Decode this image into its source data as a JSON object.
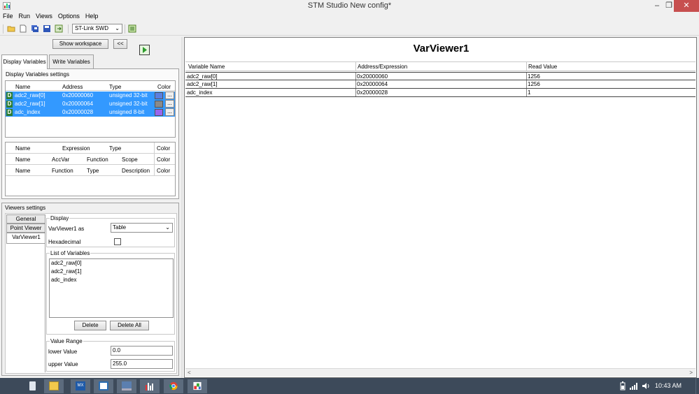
{
  "window": {
    "title": "STM Studio New config*",
    "controls": [
      "–",
      "❐",
      "✕"
    ]
  },
  "menu": [
    "File",
    "Run",
    "Views",
    "Options",
    "Help"
  ],
  "toolbar": {
    "probe_select": "ST-Link SWD",
    "probe_arrow": "⌄"
  },
  "left": {
    "show_workspace": "Show workspace",
    "collapse": "<<",
    "tabs": [
      "Display Variables",
      "Write Variables"
    ],
    "display_settings_label": "Display Variables settings",
    "var_headers": {
      "name": "Name",
      "address": "Address",
      "type": "Type",
      "color": "Color"
    },
    "variables": [
      {
        "badge": "D",
        "name": "adc2_raw[0]",
        "address": "0x20000060",
        "type": "unsigned 32-bit",
        "color": "#5b7fe0",
        "more": "..."
      },
      {
        "badge": "D",
        "name": "adc2_raw[1]",
        "address": "0x20000064",
        "type": "unsigned 32-bit",
        "color": "#8a8a8a",
        "more": "..."
      },
      {
        "badge": "D",
        "name": "adc_index",
        "address": "0x20000028",
        "type": "unsigned 8-bit",
        "color": "#9966ee",
        "more": "..."
      }
    ],
    "expr_headers": {
      "name": "Name",
      "expression": "Expression",
      "type": "Type",
      "color": "Color"
    },
    "acc_headers": {
      "name": "Name",
      "accvar": "AccVar",
      "function": "Function",
      "scope": "Scope",
      "color": "Color"
    },
    "func_headers": {
      "name": "Name",
      "function": "Function",
      "type": "Type",
      "description": "Description",
      "color": "Color"
    }
  },
  "viewers_settings": {
    "label": "Viewers settings",
    "tabs": [
      "General",
      "Point Viewer",
      "VarViewer1"
    ],
    "display_group": "Display",
    "display_as_label": "VarViewer1 as",
    "display_as_value": "Table",
    "hex_label": "Hexadecimal",
    "hex_checked": false,
    "list_group": "List of Variables",
    "list_items": [
      "adc2_raw[0]",
      "adc2_raw[1]",
      "adc_index"
    ],
    "delete": "Delete",
    "delete_all": "Delete All",
    "range_group": "Value Range",
    "lower_label": "lower Value",
    "lower_value": "0.0",
    "upper_label": "upper Value",
    "upper_value": "255.0"
  },
  "viewer": {
    "title": "VarViewer1",
    "headers": {
      "name": "Variable Name",
      "address": "Address/Expression",
      "value": "Read Value"
    },
    "rows": [
      {
        "name": "adc2_raw[0]",
        "address": "0x20000060",
        "value": "1256"
      },
      {
        "name": "adc2_raw[1]",
        "address": "0x20000064",
        "value": "1256"
      },
      {
        "name": "adc_index",
        "address": "0x20000028",
        "value": "1"
      }
    ],
    "scroll_left": "<",
    "scroll_right": ">"
  },
  "taskbar": {
    "clock": "10:43 AM",
    "apps": [
      "phone-app",
      "file-explorer",
      "stm32cubemx",
      "app-store-window",
      "remote-desktop",
      "stm-studio",
      "chrome",
      "paint"
    ],
    "tray": [
      "battery-icon",
      "signal-icon",
      "volume-icon"
    ]
  },
  "colors": {
    "selection": "#3399ff",
    "taskbar": "#3d4a5a",
    "close": "#c74f4f"
  }
}
